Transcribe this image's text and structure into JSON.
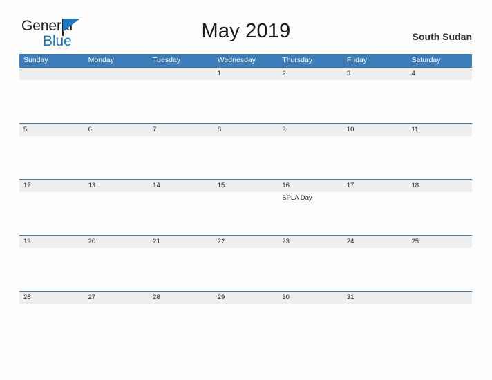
{
  "brand": {
    "name_part1": "General",
    "name_part2": "Blue",
    "accent_color": "#1f78c1",
    "flag_icon": "general-blue-flag-icon"
  },
  "header": {
    "title": "May 2019",
    "country": "South Sudan"
  },
  "calendar": {
    "month": "May",
    "year": "2019",
    "header_bg_color": "#3b7cb9",
    "date_band_color": "#eeeeee",
    "day_names": [
      "Sunday",
      "Monday",
      "Tuesday",
      "Wednesday",
      "Thursday",
      "Friday",
      "Saturday"
    ],
    "weeks": [
      {
        "days": [
          {
            "date": "",
            "events": []
          },
          {
            "date": "",
            "events": []
          },
          {
            "date": "",
            "events": []
          },
          {
            "date": "1",
            "events": []
          },
          {
            "date": "2",
            "events": []
          },
          {
            "date": "3",
            "events": []
          },
          {
            "date": "4",
            "events": []
          }
        ]
      },
      {
        "days": [
          {
            "date": "5",
            "events": []
          },
          {
            "date": "6",
            "events": []
          },
          {
            "date": "7",
            "events": []
          },
          {
            "date": "8",
            "events": []
          },
          {
            "date": "9",
            "events": []
          },
          {
            "date": "10",
            "events": []
          },
          {
            "date": "11",
            "events": []
          }
        ]
      },
      {
        "days": [
          {
            "date": "12",
            "events": []
          },
          {
            "date": "13",
            "events": []
          },
          {
            "date": "14",
            "events": []
          },
          {
            "date": "15",
            "events": []
          },
          {
            "date": "16",
            "events": [
              "SPLA Day"
            ]
          },
          {
            "date": "17",
            "events": []
          },
          {
            "date": "18",
            "events": []
          }
        ]
      },
      {
        "days": [
          {
            "date": "19",
            "events": []
          },
          {
            "date": "20",
            "events": []
          },
          {
            "date": "21",
            "events": []
          },
          {
            "date": "22",
            "events": []
          },
          {
            "date": "23",
            "events": []
          },
          {
            "date": "24",
            "events": []
          },
          {
            "date": "25",
            "events": []
          }
        ]
      },
      {
        "days": [
          {
            "date": "26",
            "events": []
          },
          {
            "date": "27",
            "events": []
          },
          {
            "date": "28",
            "events": []
          },
          {
            "date": "29",
            "events": []
          },
          {
            "date": "30",
            "events": []
          },
          {
            "date": "31",
            "events": []
          },
          {
            "date": "",
            "events": []
          }
        ]
      }
    ]
  }
}
